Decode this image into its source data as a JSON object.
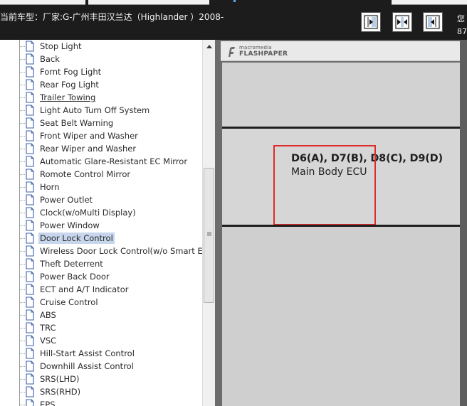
{
  "header": {
    "vehicle_info": "当前车型：厂家:G-广州丰田汉兰达（Highlander ）2008-",
    "right_text_line1": "您",
    "right_text_line2": "87",
    "nav_buttons": [
      {
        "name": "prev-page-button",
        "icon": "arrow-right-boxed-icon"
      },
      {
        "name": "fit-page-button",
        "icon": "arrows-inward-icon"
      },
      {
        "name": "next-page-button",
        "icon": "arrow-left-boxed-icon"
      }
    ]
  },
  "tree": {
    "items": [
      {
        "label": "Stop Light"
      },
      {
        "label": "Back"
      },
      {
        "label": "Fornt Fog Light"
      },
      {
        "label": "Rear Fog Light"
      },
      {
        "label": "Trailer Towing",
        "underlined": true
      },
      {
        "label": "Light Auto Turn Off System"
      },
      {
        "label": "Seat Belt Warning"
      },
      {
        "label": "Front Wiper and Washer"
      },
      {
        "label": "Rear Wiper and Washer"
      },
      {
        "label": "Automatic Glare-Resistant EC Mirror"
      },
      {
        "label": "Romote Control Mirror"
      },
      {
        "label": "Horn"
      },
      {
        "label": "Power Outlet"
      },
      {
        "label": "Clock(w/oMulti Display)"
      },
      {
        "label": "Power Window"
      },
      {
        "label": "Door Lock Control",
        "selected": true
      },
      {
        "label": "Wireless Door Lock Control(w/o Smart E"
      },
      {
        "label": "Theft Deterrent"
      },
      {
        "label": "Power Back Door"
      },
      {
        "label": "ECT and A/T Indicator"
      },
      {
        "label": "Cruise Control"
      },
      {
        "label": "ABS"
      },
      {
        "label": "TRC"
      },
      {
        "label": "VSC"
      },
      {
        "label": "Hill-Start Assist Control"
      },
      {
        "label": "Downhill Assist Control"
      },
      {
        "label": "SRS(LHD)"
      },
      {
        "label": "SRS(RHD)"
      },
      {
        "label": "EPS"
      }
    ]
  },
  "viewer": {
    "logo_small": "macromedia",
    "logo_big": "FLASHPAPER",
    "connector_title": "D6(A), D7(B), D8(C), D9(D)",
    "connector_subtitle": "Main Body ECU",
    "highlight_color": "#e02b2b"
  }
}
